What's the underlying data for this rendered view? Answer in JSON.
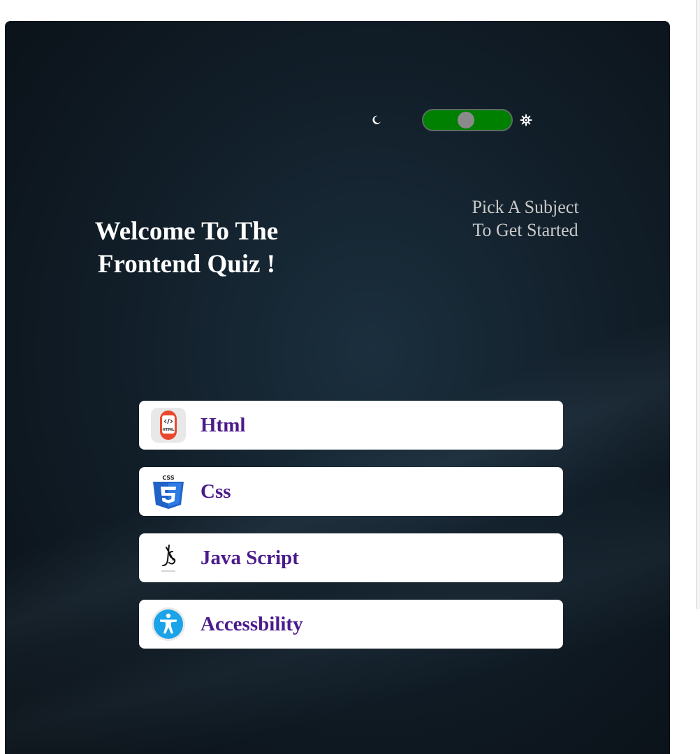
{
  "theme": {
    "dark_icon": "moon-icon",
    "light_icon": "sun-icon",
    "toggle_track_color": "#008000",
    "toggle_knob_color": "#8a8a8a"
  },
  "hero": {
    "welcome_line1": "Welcome To The",
    "welcome_line2": "Frontend Quiz !",
    "pick_line1": "Pick A Subject",
    "pick_line2": "To Get Started"
  },
  "subjects": [
    {
      "label": "Html",
      "icon": "html-icon"
    },
    {
      "label": "Css",
      "icon": "css-icon"
    },
    {
      "label": "Java Script",
      "icon": "javascript-icon"
    },
    {
      "label": "Accessbility",
      "icon": "accessibility-icon"
    }
  ],
  "colors": {
    "label_text": "#4b1a8c",
    "card_bg": "#ffffff",
    "title_text": "#ffffff",
    "subtitle_text": "#c9c9c9"
  }
}
